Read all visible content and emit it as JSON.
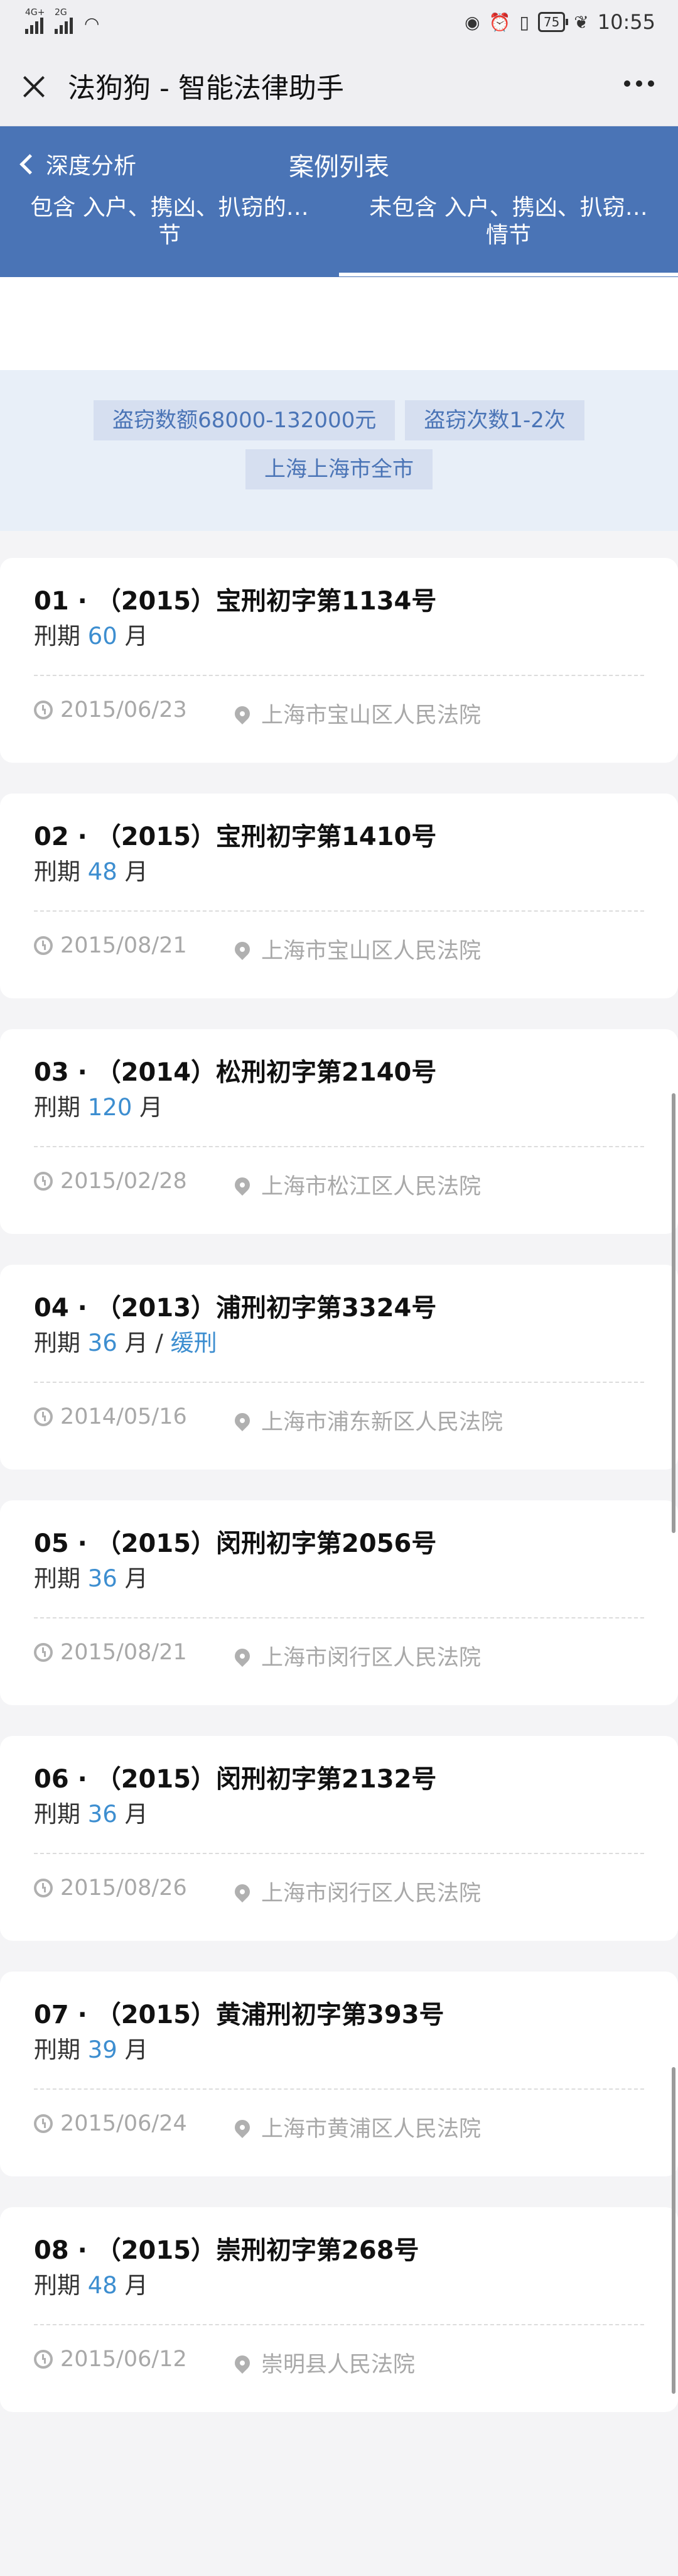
{
  "status_bar": {
    "net1": "4G+",
    "net2": "2G",
    "battery": "75",
    "time": "10:55"
  },
  "titlebar": {
    "title": "法狗狗 - 智能法律助手"
  },
  "header": {
    "back_label": "深度分析",
    "title": "案例列表",
    "tabs": [
      {
        "line1": "包含 入户、携凶、扒窃的…",
        "line2": "节"
      },
      {
        "line1": "未包含 入户、携凶、扒窃…",
        "line2": "情节"
      }
    ]
  },
  "filters": [
    "盗窃数额68000-132000元",
    "盗窃次数1-2次",
    "上海上海市全市"
  ],
  "sentence_label": "刑期",
  "month_unit": "月",
  "cases": [
    {
      "title": "01 · （2015）宝刑初字第1134号",
      "months": "60",
      "extra": "",
      "date": "2015/06/23",
      "court": "上海市宝山区人民法院"
    },
    {
      "title": "02 · （2015）宝刑初字第1410号",
      "months": "48",
      "extra": "",
      "date": "2015/08/21",
      "court": "上海市宝山区人民法院"
    },
    {
      "title": "03 · （2014）松刑初字第2140号",
      "months": "120",
      "extra": "",
      "date": "2015/02/28",
      "court": "上海市松江区人民法院"
    },
    {
      "title": "04 · （2013）浦刑初字第3324号",
      "months": "36",
      "extra": "缓刑",
      "date": "2014/05/16",
      "court": "上海市浦东新区人民法院"
    },
    {
      "title": "05 · （2015）闵刑初字第2056号",
      "months": "36",
      "extra": "",
      "date": "2015/08/21",
      "court": "上海市闵行区人民法院"
    },
    {
      "title": "06 · （2015）闵刑初字第2132号",
      "months": "36",
      "extra": "",
      "date": "2015/08/26",
      "court": "上海市闵行区人民法院"
    },
    {
      "title": "07 · （2015）黄浦刑初字第393号",
      "months": "39",
      "extra": "",
      "date": "2015/06/24",
      "court": "上海市黄浦区人民法院"
    },
    {
      "title": "08 · （2015）崇刑初字第268号",
      "months": "48",
      "extra": "",
      "date": "2015/06/12",
      "court": "崇明县人民法院"
    }
  ]
}
